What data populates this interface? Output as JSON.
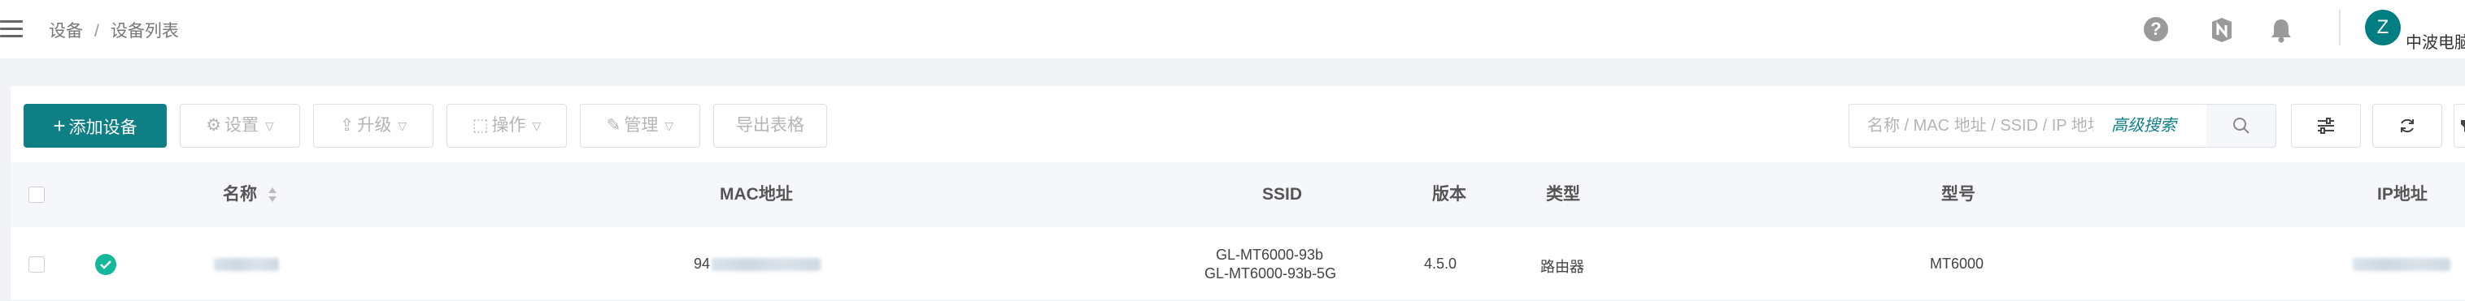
{
  "header": {
    "breadcrumb": [
      "设备",
      "设备列表"
    ],
    "breadcrumb_sep": "/",
    "user": {
      "avatar_letter": "Z",
      "name": "中波电脑"
    }
  },
  "toolbar": {
    "add_device": "添加设备",
    "settings": "设置",
    "upgrade": "升级",
    "operate": "操作",
    "manage": "管理",
    "export": "导出表格",
    "search_placeholder": "名称 / MAC 地址 / SSID / IP 地址",
    "advanced_search": "高级搜索"
  },
  "table": {
    "columns": [
      "名称",
      "MAC地址",
      "SSID",
      "版本",
      "类型",
      "型号",
      "IP地址"
    ],
    "rows": [
      {
        "status": "online",
        "mac_prefix": "94",
        "ssid": [
          "GL-MT6000-93b",
          "GL-MT6000-93b-5G"
        ],
        "version": "4.5.0",
        "type": "路由器",
        "model": "MT6000"
      }
    ]
  },
  "colors": {
    "accent": "#0f7f86",
    "online": "#13b79a"
  }
}
